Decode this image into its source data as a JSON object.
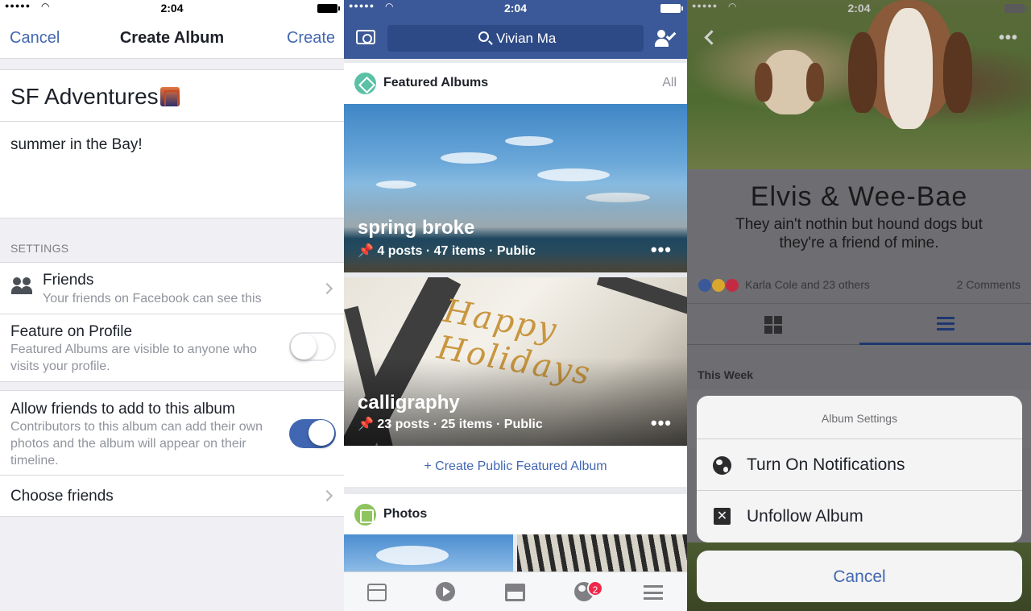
{
  "status": {
    "time": "2:04",
    "signal": "●●●●●",
    "wifi": "◠"
  },
  "create_album": {
    "nav": {
      "cancel": "Cancel",
      "title": "Create Album",
      "create": "Create"
    },
    "album_name": "SF Adventures",
    "description": "summer in the Bay!",
    "settings_header": "SETTINGS",
    "privacy": {
      "title": "Friends",
      "subtitle": "Your friends on Facebook can see this"
    },
    "feature": {
      "title": "Feature on Profile",
      "subtitle": "Featured Albums are visible to anyone who visits your profile.",
      "enabled": false
    },
    "contributors": {
      "title": "Allow friends to add to this album",
      "subtitle": "Contributors to this album can add their own photos and the album will appear on their timeline.",
      "enabled": true
    },
    "choose_friends": "Choose friends"
  },
  "profile_albums": {
    "search_value": "Vivian Ma",
    "featured": {
      "title": "Featured Albums",
      "all": "All"
    },
    "albums": [
      {
        "title": "spring broke",
        "meta": "4 posts · 47 items · Public",
        "more": "•••"
      },
      {
        "title": "calligraphy",
        "meta": "23 posts · 25 items · Public",
        "more": "•••",
        "script": "Happy Holidays"
      }
    ],
    "create_featured": "+ Create Public Featured Album",
    "photos": {
      "title": "Photos"
    },
    "notifications_count": "2",
    "colors": {
      "brand": "#3b5998",
      "link": "#4267b2",
      "badge": "#f02849"
    }
  },
  "album_view": {
    "more": "•••",
    "title": "Elvis & Wee-Bae",
    "description": "They ain't nothin but hound dogs but they're a friend of mine.",
    "reactions": [
      "like",
      "wow",
      "love"
    ],
    "reacted_by": "Karla Cole and 23 others",
    "comments": "2 Comments",
    "section": "This Week",
    "action_sheet": {
      "title": "Album Settings",
      "items": [
        {
          "label": "Turn On Notifications",
          "icon": "globe-icon"
        },
        {
          "label": "Unfollow Album",
          "icon": "unfollow-icon"
        }
      ],
      "cancel": "Cancel"
    }
  }
}
